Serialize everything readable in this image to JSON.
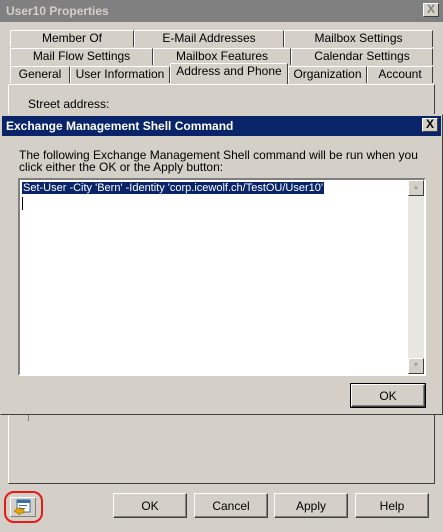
{
  "properties_window": {
    "title": "User10 Properties",
    "close_label": "X",
    "tabs_row1": [
      "Member Of",
      "E-Mail Addresses",
      "Mailbox Settings"
    ],
    "tabs_row2": [
      "Mail Flow Settings",
      "Mailbox Features",
      "Calendar Settings"
    ],
    "tabs_row3": [
      "General",
      "User Information",
      "Address and Phone",
      "Organization",
      "Account"
    ],
    "active_tab": "Address and Phone",
    "street_label": "Street address:",
    "buttons": {
      "ok": "OK",
      "cancel": "Cancel",
      "apply": "Apply",
      "help": "Help"
    }
  },
  "ems_dialog": {
    "title": "Exchange Management Shell Command",
    "close_label": "X",
    "description": "The following Exchange Management Shell command will be run when you click either the OK or the Apply button:",
    "command": "Set-User -City 'Bern' -Identity 'corp.icewolf.ch/TestOU/User10'",
    "ok_label": "OK"
  },
  "colors": {
    "active_title": "#0a246a",
    "inactive_title": "#808080",
    "face": "#d4d0c8",
    "highlight_ring": "#e41b17"
  }
}
